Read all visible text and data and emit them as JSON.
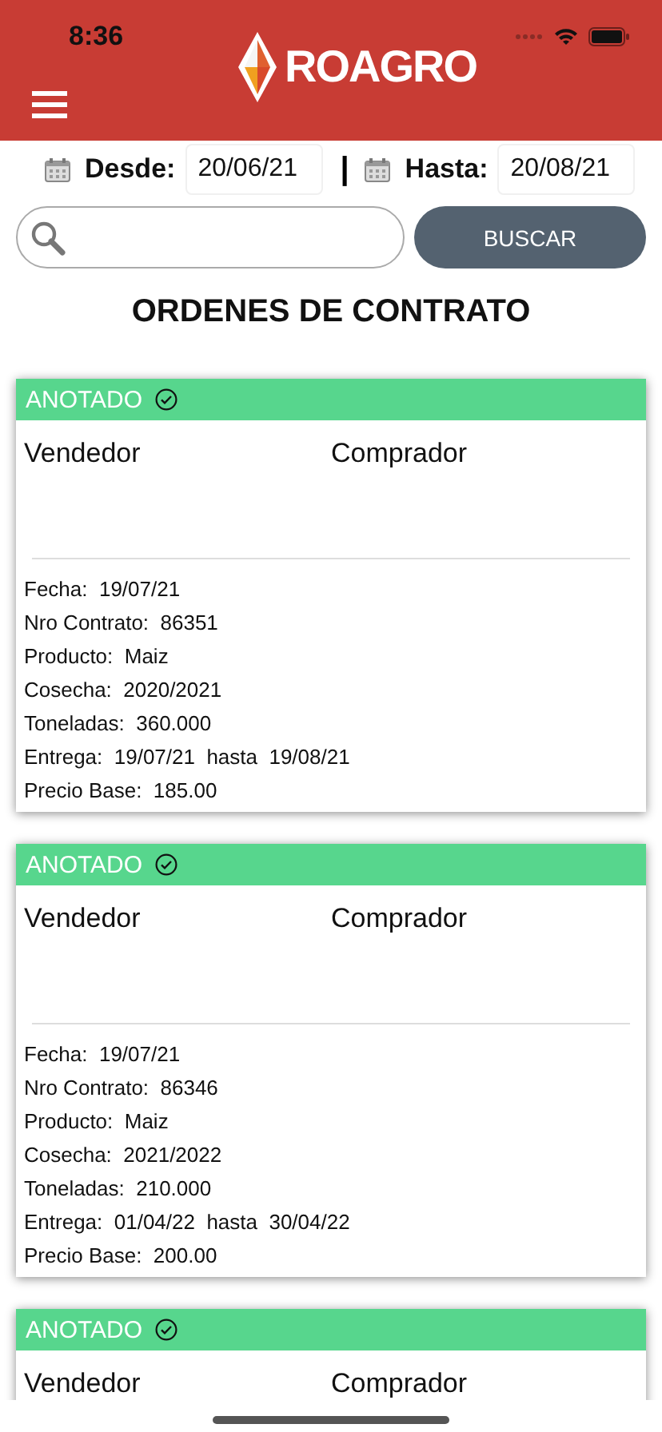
{
  "status_bar": {
    "time": "8:36"
  },
  "header": {
    "brand": "ROAGRO"
  },
  "date_filter": {
    "from_label": "Desde:",
    "from_value": "20/06/21",
    "separator": "|",
    "to_label": "Hasta:",
    "to_value": "20/08/21"
  },
  "search": {
    "button": "BUSCAR"
  },
  "title": "ORDENES DE CONTRATO",
  "cards": [
    {
      "status": {
        "label": "ANOTADO",
        "color": "#57d68d"
      },
      "seller": "Vendedor",
      "buyer": "Comprador",
      "fields": [
        {
          "label": "Fecha:",
          "value": "19/07/21"
        },
        {
          "label": "Nro Contrato:",
          "value": "86351"
        },
        {
          "label": "Producto:",
          "value": "Maiz"
        },
        {
          "label": "Cosecha:",
          "value": "2020/2021"
        },
        {
          "label": "Toneladas:",
          "value": "360.000"
        },
        {
          "label": "Entrega:",
          "value": "19/07/21  hasta  19/08/21"
        },
        {
          "label": "Precio Base:",
          "value": "185.00"
        }
      ]
    },
    {
      "status": {
        "label": "ANOTADO",
        "color": "#57d68d"
      },
      "seller": "Vendedor",
      "buyer": "Comprador",
      "fields": [
        {
          "label": "Fecha:",
          "value": "19/07/21"
        },
        {
          "label": "Nro Contrato:",
          "value": "86346"
        },
        {
          "label": "Producto:",
          "value": "Maiz"
        },
        {
          "label": "Cosecha:",
          "value": "2021/2022"
        },
        {
          "label": "Toneladas:",
          "value": "210.000"
        },
        {
          "label": "Entrega:",
          "value": "01/04/22  hasta  30/04/22"
        },
        {
          "label": "Precio Base:",
          "value": "200.00"
        }
      ]
    },
    {
      "status": {
        "label": "ANOTADO",
        "color": "#57d68d"
      },
      "seller": "Vendedor",
      "buyer": "Comprador"
    }
  ]
}
